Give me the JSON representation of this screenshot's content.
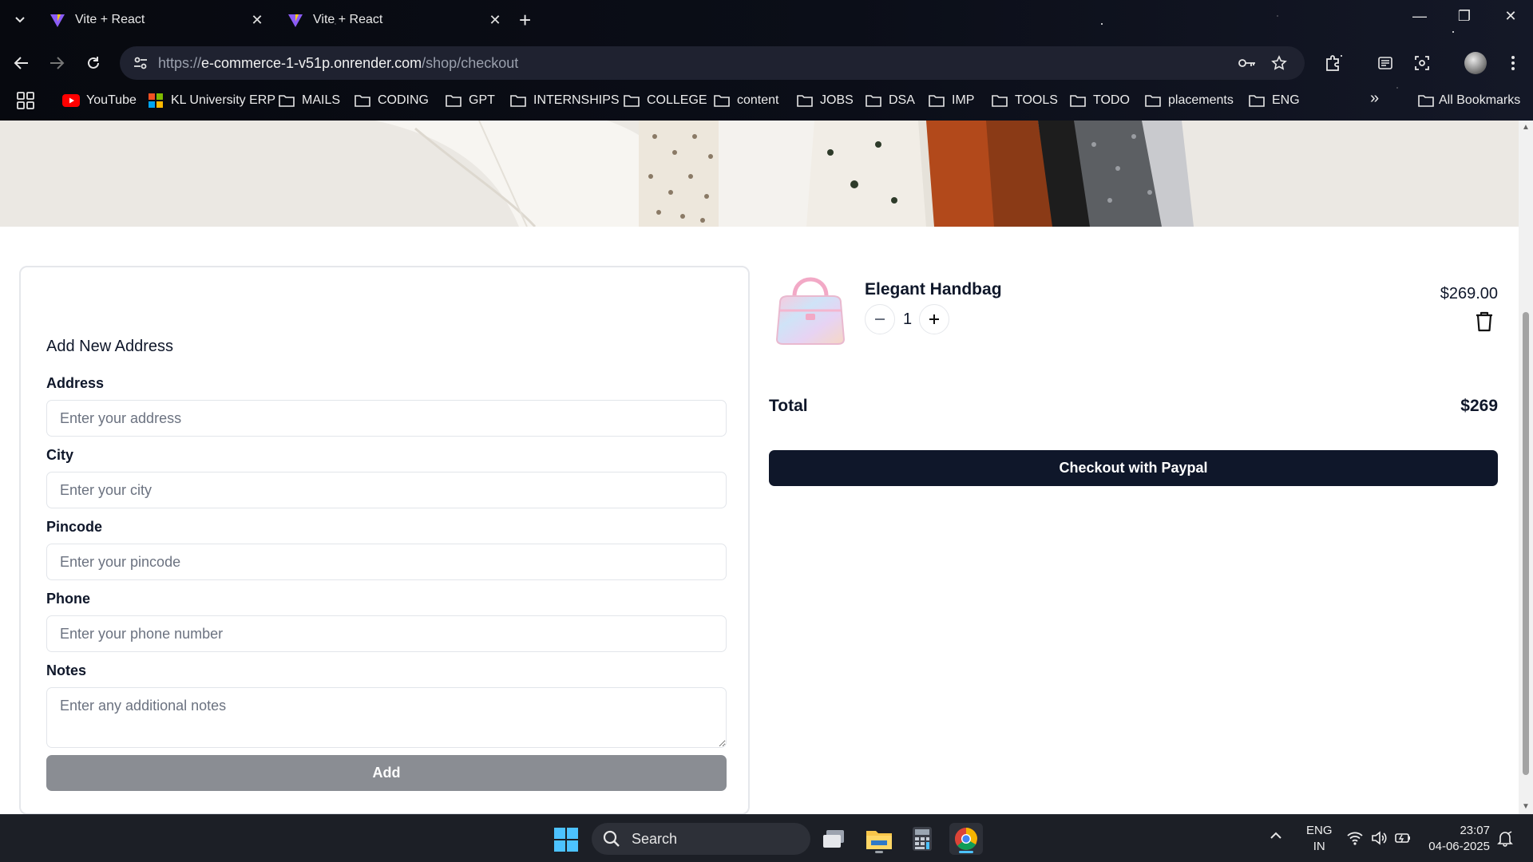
{
  "browser": {
    "tabs": [
      {
        "title": "Vite + React"
      },
      {
        "title": "Vite + React"
      }
    ],
    "url": {
      "scheme": "https://",
      "host": "e-commerce-1-v51p.onrender.com",
      "path": "/shop/checkout"
    },
    "bookmarks": [
      {
        "label": "YouTube",
        "icon": "youtube-icon"
      },
      {
        "label": "KL University ERP",
        "icon": "erp-icon"
      },
      {
        "label": "MAILS",
        "icon": "folder-icon"
      },
      {
        "label": "CODING",
        "icon": "folder-icon"
      },
      {
        "label": "GPT",
        "icon": "folder-icon"
      },
      {
        "label": "INTERNSHIPS",
        "icon": "folder-icon"
      },
      {
        "label": "COLLEGE",
        "icon": "folder-icon"
      },
      {
        "label": "content",
        "icon": "folder-icon"
      },
      {
        "label": "JOBS",
        "icon": "folder-icon"
      },
      {
        "label": "DSA",
        "icon": "folder-icon"
      },
      {
        "label": "IMP",
        "icon": "folder-icon"
      },
      {
        "label": "TOOLS",
        "icon": "folder-icon"
      },
      {
        "label": "TODO",
        "icon": "folder-icon"
      },
      {
        "label": "placements",
        "icon": "folder-icon"
      },
      {
        "label": "ENG",
        "icon": "folder-icon"
      }
    ],
    "all_bookmarks": "All Bookmarks"
  },
  "address_form": {
    "heading": "Add New Address",
    "fields": [
      {
        "label": "Address",
        "placeholder": "Enter your address"
      },
      {
        "label": "City",
        "placeholder": "Enter your city"
      },
      {
        "label": "Pincode",
        "placeholder": "Enter your pincode"
      },
      {
        "label": "Phone",
        "placeholder": "Enter your phone number"
      },
      {
        "label": "Notes",
        "placeholder": "Enter any additional notes"
      }
    ],
    "submit_label": "Add"
  },
  "cart": {
    "items": [
      {
        "name": "Elegant Handbag",
        "quantity": "1",
        "price": "$269.00"
      }
    ],
    "total_label": "Total",
    "total_value": "$269",
    "checkout_label": "Checkout with Paypal"
  },
  "taskbar": {
    "search_label": "Search",
    "lang_line1": "ENG",
    "lang_line2": "IN",
    "time": "23:07",
    "date": "04-06-2025"
  },
  "colors": {
    "primary": "#0f172a",
    "disabled_button": "#8a8d93",
    "border": "#e5e7eb"
  }
}
